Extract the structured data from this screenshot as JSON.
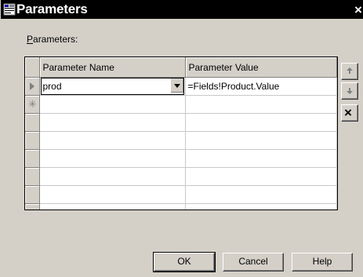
{
  "window": {
    "title": "Parameters",
    "close_glyph": "×"
  },
  "section": {
    "label_prefix": "P",
    "label_rest": "arameters:"
  },
  "grid": {
    "columns": [
      "Parameter Name",
      "Parameter Value"
    ],
    "rows": [
      {
        "name": "prod",
        "value": "=Fields!Product.Value"
      }
    ]
  },
  "side_buttons": {
    "delete_glyph": "×"
  },
  "buttons": {
    "ok": "OK",
    "cancel": "Cancel",
    "help": "Help"
  }
}
